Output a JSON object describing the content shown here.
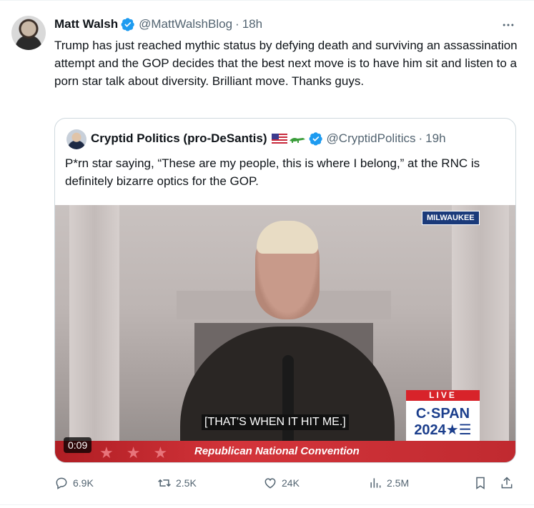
{
  "tweet": {
    "author_name": "Matt Walsh",
    "handle": "@MattWalshBlog",
    "separator": "·",
    "time": "18h",
    "text": "Trump has just reached mythic status by defying death and surviving an assassination attempt and the GOP decides that the best next move is to have him sit and listen to a porn star talk about diversity. Brilliant move. Thanks guys."
  },
  "quote": {
    "author_name": "Cryptid Politics (pro-DeSantis)",
    "handle": "@CryptidPolitics",
    "separator": "·",
    "time": "19h",
    "text": "P*rn star saying, “These are my people, this is where I belong,” at the RNC is definitely bizarre optics for the GOP.",
    "video": {
      "location_badge": "MILWAUKEE",
      "live_label": "LIVE",
      "network_line1": "C·SPAN",
      "network_line2": "2024★☰",
      "caption": "[THAT'S WHEN IT HIT ME.]",
      "banner": "Republican National Convention",
      "timestamp": "0:09"
    }
  },
  "actions": {
    "replies": "6.9K",
    "reposts": "2.5K",
    "likes": "24K",
    "views": "2.5M"
  },
  "colors": {
    "verified": "#1d9bf0",
    "secondary_text": "#536471",
    "border": "#cfd9de"
  },
  "icons": [
    "verified-badge-icon",
    "more-icon",
    "us-flag-icon",
    "alligator-icon",
    "reply-icon",
    "repost-icon",
    "like-icon",
    "views-icon",
    "bookmark-icon",
    "share-icon"
  ]
}
